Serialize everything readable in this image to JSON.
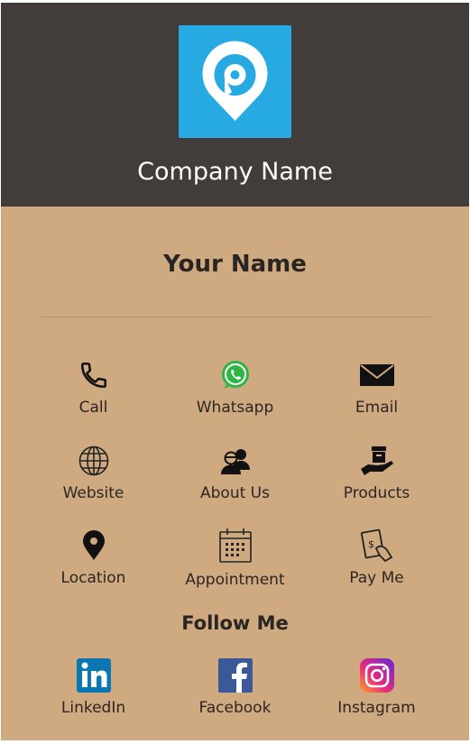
{
  "header": {
    "company_name": "Company Name",
    "logo_icon": "location-pin-logo-icon",
    "background_color": "#423d3a",
    "logo_color": "#27aae1"
  },
  "profile": {
    "name": "Your Name"
  },
  "actions": [
    {
      "label": "Call",
      "icon": "phone-icon"
    },
    {
      "label": "Whatsapp",
      "icon": "whatsapp-icon"
    },
    {
      "label": "Email",
      "icon": "email-icon"
    },
    {
      "label": "Website",
      "icon": "globe-icon"
    },
    {
      "label": "About Us",
      "icon": "people-icon"
    },
    {
      "label": "Products",
      "icon": "box-in-hand-icon"
    },
    {
      "label": "Location",
      "icon": "map-pin-icon"
    },
    {
      "label": "Appointment",
      "icon": "calendar-icon"
    },
    {
      "label": "Pay Me",
      "icon": "payment-icon"
    }
  ],
  "follow": {
    "title": "Follow Me",
    "links": [
      {
        "label": "LinkedIn",
        "icon": "linkedin-icon"
      },
      {
        "label": "Facebook",
        "icon": "facebook-icon"
      },
      {
        "label": "Instagram",
        "icon": "instagram-icon"
      }
    ]
  },
  "colors": {
    "card_background": "#cfaa80",
    "whatsapp": "#2fb543",
    "linkedin": "#0a76b4",
    "facebook": "#3b5998"
  }
}
